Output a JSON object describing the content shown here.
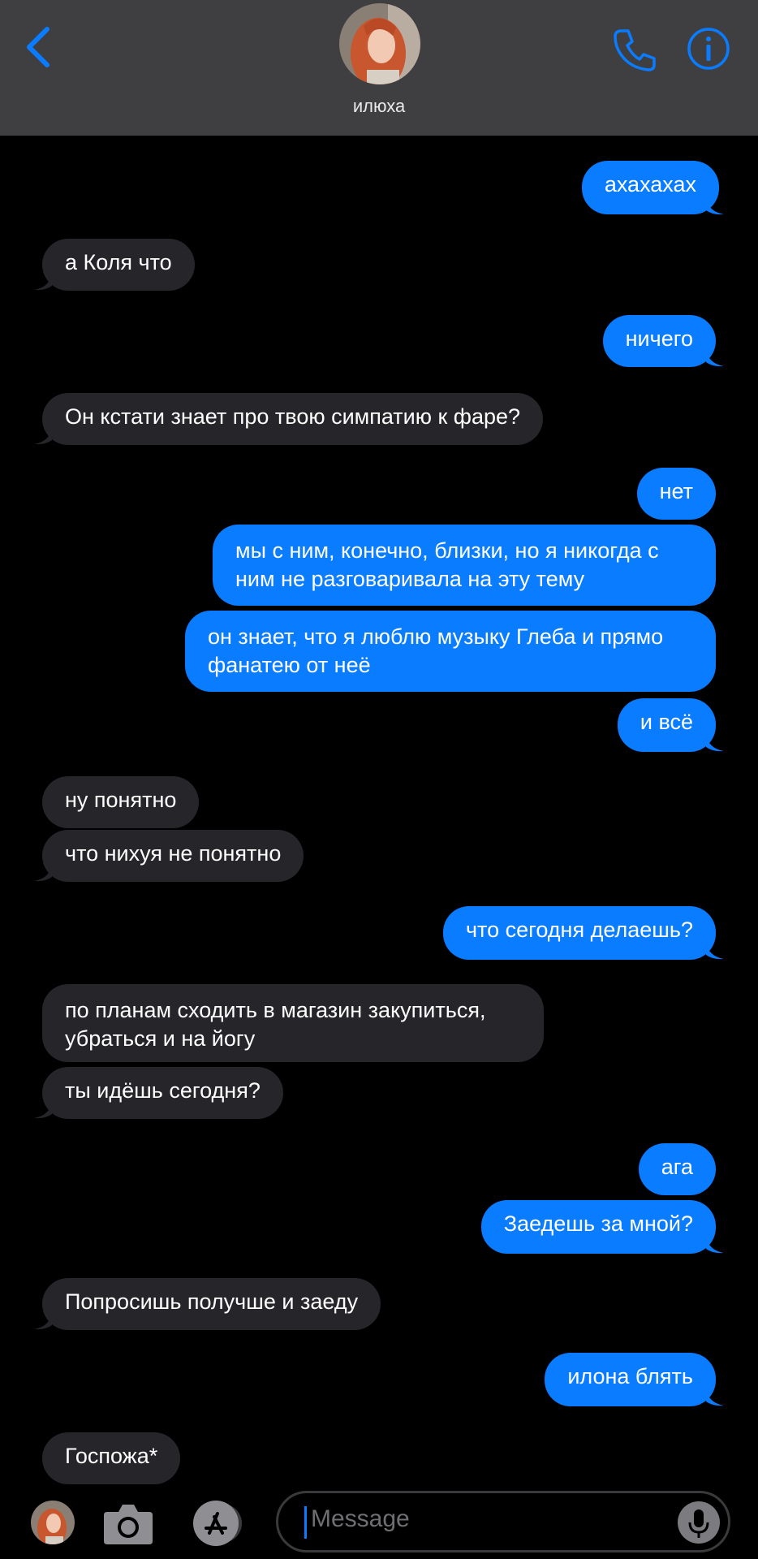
{
  "header": {
    "contact_name": "илюха",
    "back_icon": "chevron-left-icon",
    "call_icon": "phone-icon",
    "info_icon": "info-icon",
    "accent_color": "#0a7cff"
  },
  "messages": [
    {
      "from": "me",
      "text": "ахахахах"
    },
    {
      "from": "them",
      "text": "а Коля что"
    },
    {
      "from": "me",
      "text": "ничего"
    },
    {
      "from": "them",
      "text": "Он кстати знает про твою симпатию к фаре?"
    },
    {
      "from": "me",
      "text": "нет"
    },
    {
      "from": "me",
      "text": "мы с ним, конечно, близки, но я никогда с ним не разговаривала на эту тему"
    },
    {
      "from": "me",
      "text": "он знает, что я люблю музыку Глеба и прямо фанатею от неё"
    },
    {
      "from": "me",
      "text": "и всё"
    },
    {
      "from": "them",
      "text": "ну понятно"
    },
    {
      "from": "them",
      "text": "что нихуя не понятно"
    },
    {
      "from": "me",
      "text": "что сегодня делаешь?"
    },
    {
      "from": "them",
      "text": "по планам сходить в магазин закупиться, убраться и на йогу"
    },
    {
      "from": "them",
      "text": "ты идёшь сегодня?"
    },
    {
      "from": "me",
      "text": "ага"
    },
    {
      "from": "me",
      "text": "Заедешь за мной?"
    },
    {
      "from": "them",
      "text": "Попросишь получше и заеду"
    },
    {
      "from": "me",
      "text": "илона блять"
    },
    {
      "from": "them",
      "text": "Госпожа*"
    }
  ],
  "composer": {
    "placeholder": "Message",
    "camera_icon": "camera-icon",
    "appstore_icon": "app-store-icon",
    "mic_icon": "microphone-icon"
  },
  "colors": {
    "outgoing_bubble": "#0a7cff",
    "incoming_bubble": "#262529",
    "header_bg": "#3f3f41"
  }
}
